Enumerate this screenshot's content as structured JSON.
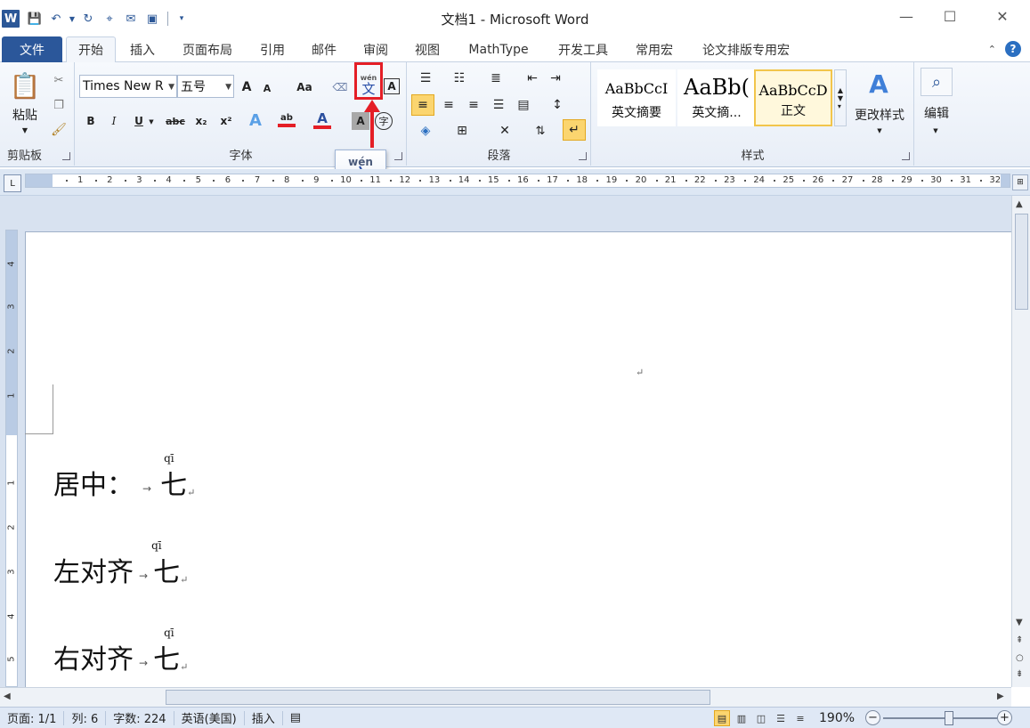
{
  "window": {
    "title": "文档1 - Microsoft Word",
    "app_icon": "W",
    "controls": [
      "—",
      "☐",
      "✕"
    ]
  },
  "qat": [
    "save-icon",
    "undo-icon",
    "redo-icon",
    "cursor-icon",
    "envelope-icon",
    "book-icon",
    "customize-icon"
  ],
  "tabs": [
    {
      "label": "文件"
    },
    {
      "label": "开始"
    },
    {
      "label": "插入"
    },
    {
      "label": "页面布局"
    },
    {
      "label": "引用"
    },
    {
      "label": "邮件"
    },
    {
      "label": "审阅"
    },
    {
      "label": "视图"
    },
    {
      "label": "MathType"
    },
    {
      "label": "开发工具"
    },
    {
      "label": "常用宏"
    },
    {
      "label": "论文排版专用宏"
    }
  ],
  "ribbon": {
    "clipboard": {
      "group_label": "剪贴板",
      "paste_label": "粘贴"
    },
    "font": {
      "group_label": "字体",
      "font_name": "Times New R",
      "font_size": "五号",
      "grow": "A",
      "shrink": "A",
      "change_case": "Aa",
      "bold": "B",
      "italic": "I",
      "underline": "U",
      "strike": "abc",
      "sub": "x₂",
      "sup": "x²",
      "text_effect": "A",
      "highlight": "ab",
      "font_color": "A",
      "char_shade": "A",
      "enclose": "字",
      "border": "A",
      "phonetic_py": "wén",
      "phonetic_hz": "文"
    },
    "paragraph": {
      "group_label": "段落"
    },
    "styles": {
      "group_label": "样式",
      "items": [
        {
          "preview": "AaBbCcI",
          "name": "英文摘要"
        },
        {
          "preview": "AaBb(",
          "name": "英文摘..."
        },
        {
          "preview": "AaBbCcD",
          "name": "正文"
        }
      ],
      "change_label": "更改样式"
    },
    "editing": {
      "group_label": "编辑"
    }
  },
  "tooltip": {
    "pinyin": "wén",
    "hanzi": "文"
  },
  "ruler": {
    "numbers": [
      "1",
      "2",
      "3",
      "4",
      "5",
      "6",
      "7",
      "8",
      "9",
      "10",
      "11",
      "12",
      "13",
      "14",
      "15",
      "16",
      "17",
      "18",
      "19",
      "20",
      "21",
      "22",
      "23",
      "24",
      "25",
      "26",
      "27",
      "28",
      "29",
      "30",
      "31",
      "32"
    ],
    "vnumbers": [
      "4",
      "3",
      "2",
      "1",
      "1",
      "2",
      "3",
      "4",
      "5"
    ]
  },
  "document": {
    "paragraph_mark": "↵",
    "lines": [
      {
        "label": "居中：",
        "tab": "→",
        "char": "七",
        "pinyin": "qī",
        "end": "↵"
      },
      {
        "label": "左对齐",
        "tab": "→",
        "char": "七",
        "pinyin": "qī",
        "end": "↵"
      },
      {
        "label": "右对齐",
        "tab": "→",
        "char": "七",
        "pinyin": "qī",
        "end": "↵"
      }
    ]
  },
  "status": {
    "page": "页面: 1/1",
    "column": "列: 6",
    "words": "字数: 224",
    "language": "英语(美国)",
    "mode": "插入",
    "zoom": "190%",
    "zoom_level": 0.55
  },
  "colors": {
    "accent": "#2b579a",
    "annotation": "#e41e26",
    "highlight": "#fbd56f"
  }
}
